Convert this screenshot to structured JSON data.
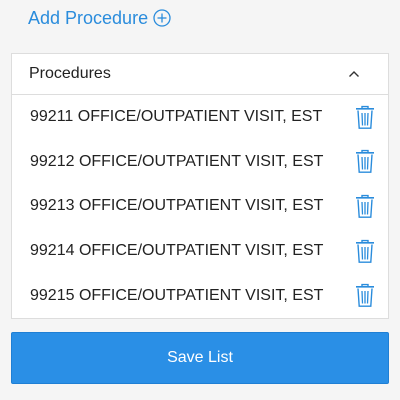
{
  "add_procedure": {
    "label": "Add Procedure",
    "icon": "plus-circle-icon"
  },
  "panel": {
    "title": "Procedures",
    "toggle_icon": "chevron-up-icon",
    "items": [
      {
        "label": "99211 OFFICE/OUTPATIENT VISIT, EST",
        "icon": "trash-icon"
      },
      {
        "label": "99212 OFFICE/OUTPATIENT VISIT, EST",
        "icon": "trash-icon"
      },
      {
        "label": "99213 OFFICE/OUTPATIENT VISIT, EST",
        "icon": "trash-icon"
      },
      {
        "label": "99214 OFFICE/OUTPATIENT VISIT, EST",
        "icon": "trash-icon"
      },
      {
        "label": "99215 OFFICE/OUTPATIENT VISIT, EST",
        "icon": "trash-icon"
      }
    ]
  },
  "save_button": {
    "label": "Save List"
  },
  "colors": {
    "accent": "#2a8cdc",
    "button": "#2a8fe6",
    "text": "#222222",
    "border": "#dddddd",
    "background": "#f5f5f5"
  }
}
